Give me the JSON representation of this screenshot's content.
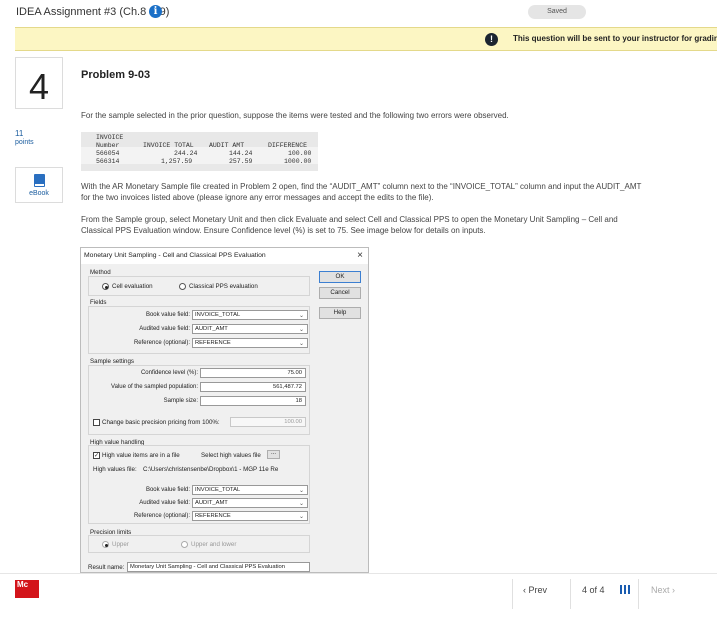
{
  "header": {
    "assignment_title": "IDEA Assignment #3 (Ch.8 & 9)",
    "info_icon": "info-circle-icon",
    "status": "Saved"
  },
  "banner": {
    "icon": "exclamation-icon",
    "text": "This question will be sent to your instructor for grading."
  },
  "question": {
    "number": "4",
    "points_value": "11",
    "points_label": "points",
    "ebook_label": "eBook",
    "title": "Problem 9-03",
    "intro": "For the sample selected in the prior question, suppose the items were tested and the following two errors were observed.",
    "instructions_1": "With the AR Monetary Sample file created in Problem 2 open, find the “AUDIT_AMT” column next to the “INVOICE_TOTAL” column and input the AUDIT_AMT for the two invoices listed above (please ignore any error messages and accept the edits to the file).",
    "instructions_2": "From the Sample group, select Monetary Unit and then click Evaluate and select Cell and Classical PPS to open the Monetary Unit Sampling – Cell and Classical PPS Evaluation window. Ensure Confidence level (%) is set to 75. See image below for details on inputs."
  },
  "error_table": {
    "headers": [
      "INVOICE\nNumber",
      "INVOICE TOTAL",
      "AUDIT AMT",
      "DIFFERENCE"
    ],
    "header_line1": "INVOICE",
    "header_number": "Number",
    "header_total": "INVOICE TOTAL",
    "header_audit": "AUDIT AMT",
    "header_diff": "DIFFERENCE",
    "rows": [
      {
        "number": "566054",
        "total": "244.24",
        "audit": "144.24",
        "diff": "100.00"
      },
      {
        "number": "566314",
        "total": "1,257.59",
        "audit": "257.59",
        "diff": "1000.00"
      }
    ]
  },
  "dialog": {
    "title": "Monetary Unit Sampling - Cell and Classical PPS Evaluation",
    "close": "×",
    "method_label": "Method",
    "cell_eval": "Cell evaluation",
    "classical_eval": "Classical PPS evaluation",
    "fields_label": "Fields",
    "book_value_label": "Book value field:",
    "book_value": "INVOICE_TOTAL",
    "audited_label": "Audited value field:",
    "audited_value": "AUDIT_AMT",
    "reference_label": "Reference (optional):",
    "reference_value": "REFERENCE",
    "sample_settings_label": "Sample settings",
    "confidence_label": "Confidence level (%):",
    "confidence_value": "75.00",
    "population_label": "Value of the sampled population:",
    "population_value": "561,487.72",
    "sample_size_label": "Sample size:",
    "sample_size_value": "18",
    "change_precision_label": "Change basic precision pricing from 100%:",
    "change_precision_value": "100.00",
    "high_value_label": "High value handling",
    "high_in_file_label": "High value items are in a file",
    "select_high_label": "Select high values file",
    "dots_label": "...",
    "high_values_file_label": "High values file:",
    "high_values_file_value": "C:\\Users\\christensenbe\\Dropbox\\1 - MGP 11e Re",
    "hv_book_value": "INVOICE_TOTAL",
    "hv_audited_value": "AUDIT_AMT",
    "hv_reference_value": "REFERENCE",
    "precision_limits_label": "Precision limits",
    "upper_label": "Upper",
    "upper_lower_label": "Upper and lower",
    "result_name_label": "Result name:",
    "result_name_value": "Monetary Unit Sampling - Cell and Classical PPS Evaluation",
    "ok_label": "OK",
    "cancel_label": "Cancel",
    "help_label": "Help"
  },
  "footer": {
    "logo_text": "Mc",
    "prev_label": "‹ Prev",
    "page_count": "4 of 4",
    "next_label": "Next ›"
  }
}
